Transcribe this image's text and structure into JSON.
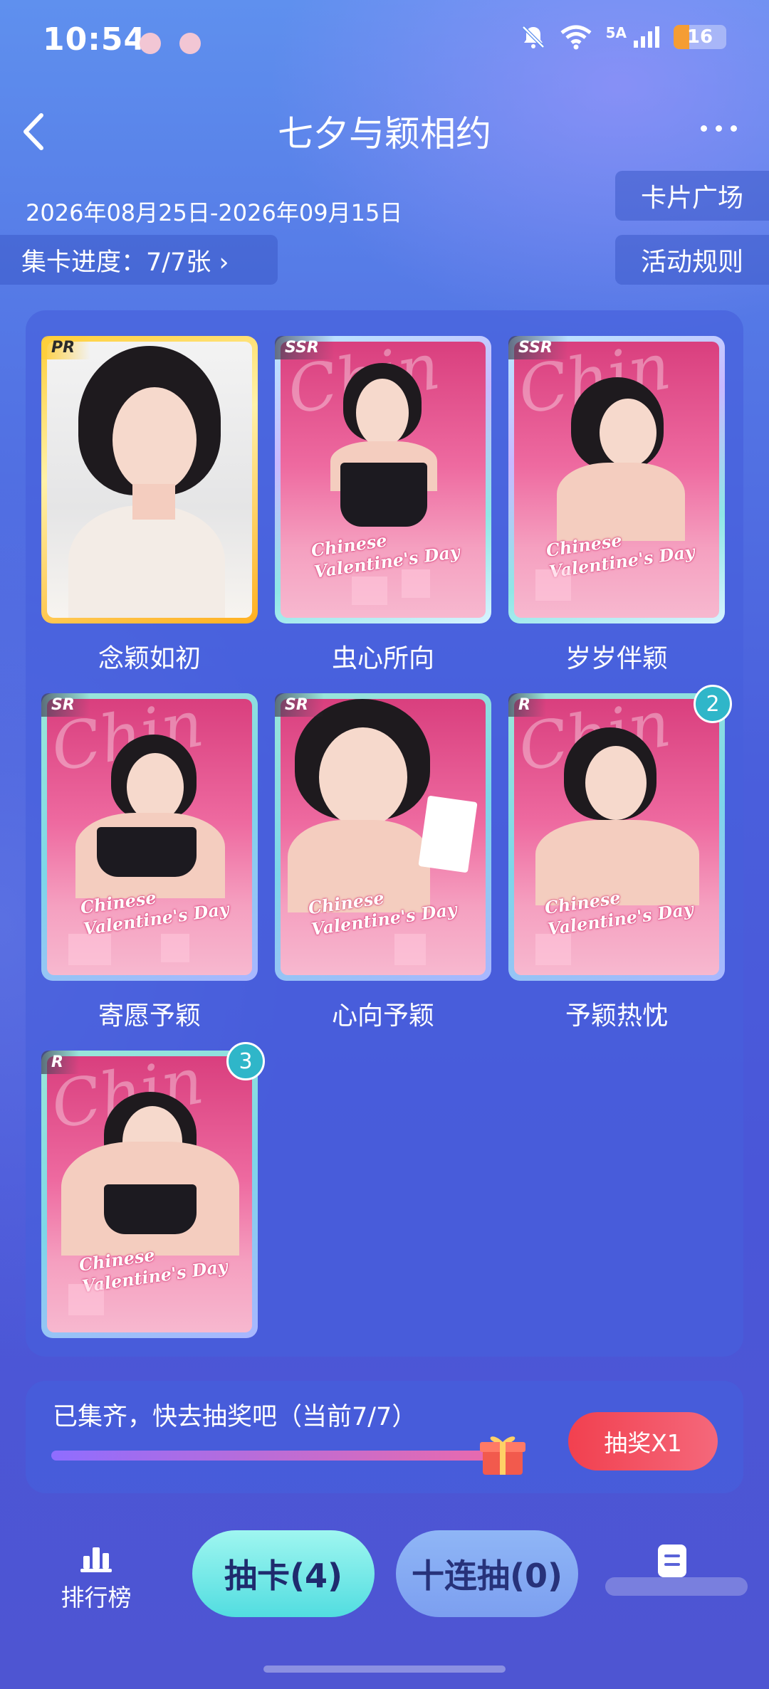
{
  "status_bar": {
    "time": "10:54",
    "signal": "5A",
    "battery": "16"
  },
  "header": {
    "title": "七夕与颖相约"
  },
  "event": {
    "date_range": "2026年08月25日-2026年09月15日",
    "progress_label": "集卡进度：7/7张 ›",
    "plaza_button": "卡片广场",
    "rules_button": "活动规则"
  },
  "cards": [
    {
      "name": "念颖如初",
      "rarity": "PR"
    },
    {
      "name": "虫心所向",
      "rarity": "SSR"
    },
    {
      "name": "岁岁伴颖",
      "rarity": "SSR"
    },
    {
      "name": "寄愿予颖",
      "rarity": "SR"
    },
    {
      "name": "心向予颖",
      "rarity": "SR"
    },
    {
      "name": "予颖热忱",
      "rarity": "R",
      "count": "2"
    },
    {
      "name": "",
      "rarity": "R",
      "count": "3"
    }
  ],
  "card_art": {
    "script": "Chinese Valentine's Day"
  },
  "draw_panel": {
    "message": "已集齐，快去抽奖吧（当前7/7）",
    "progress_fraction": 1.0,
    "lottery_button": "抽奖X1"
  },
  "bottom_nav": {
    "ranking_label": "排行榜",
    "draw_button": "抽卡(4)",
    "ten_draw_button": "十连抽(0)"
  },
  "colors": {
    "lottery": "#f2404f",
    "draw": "#52dde0",
    "ten_draw": "#7c9ff0"
  }
}
